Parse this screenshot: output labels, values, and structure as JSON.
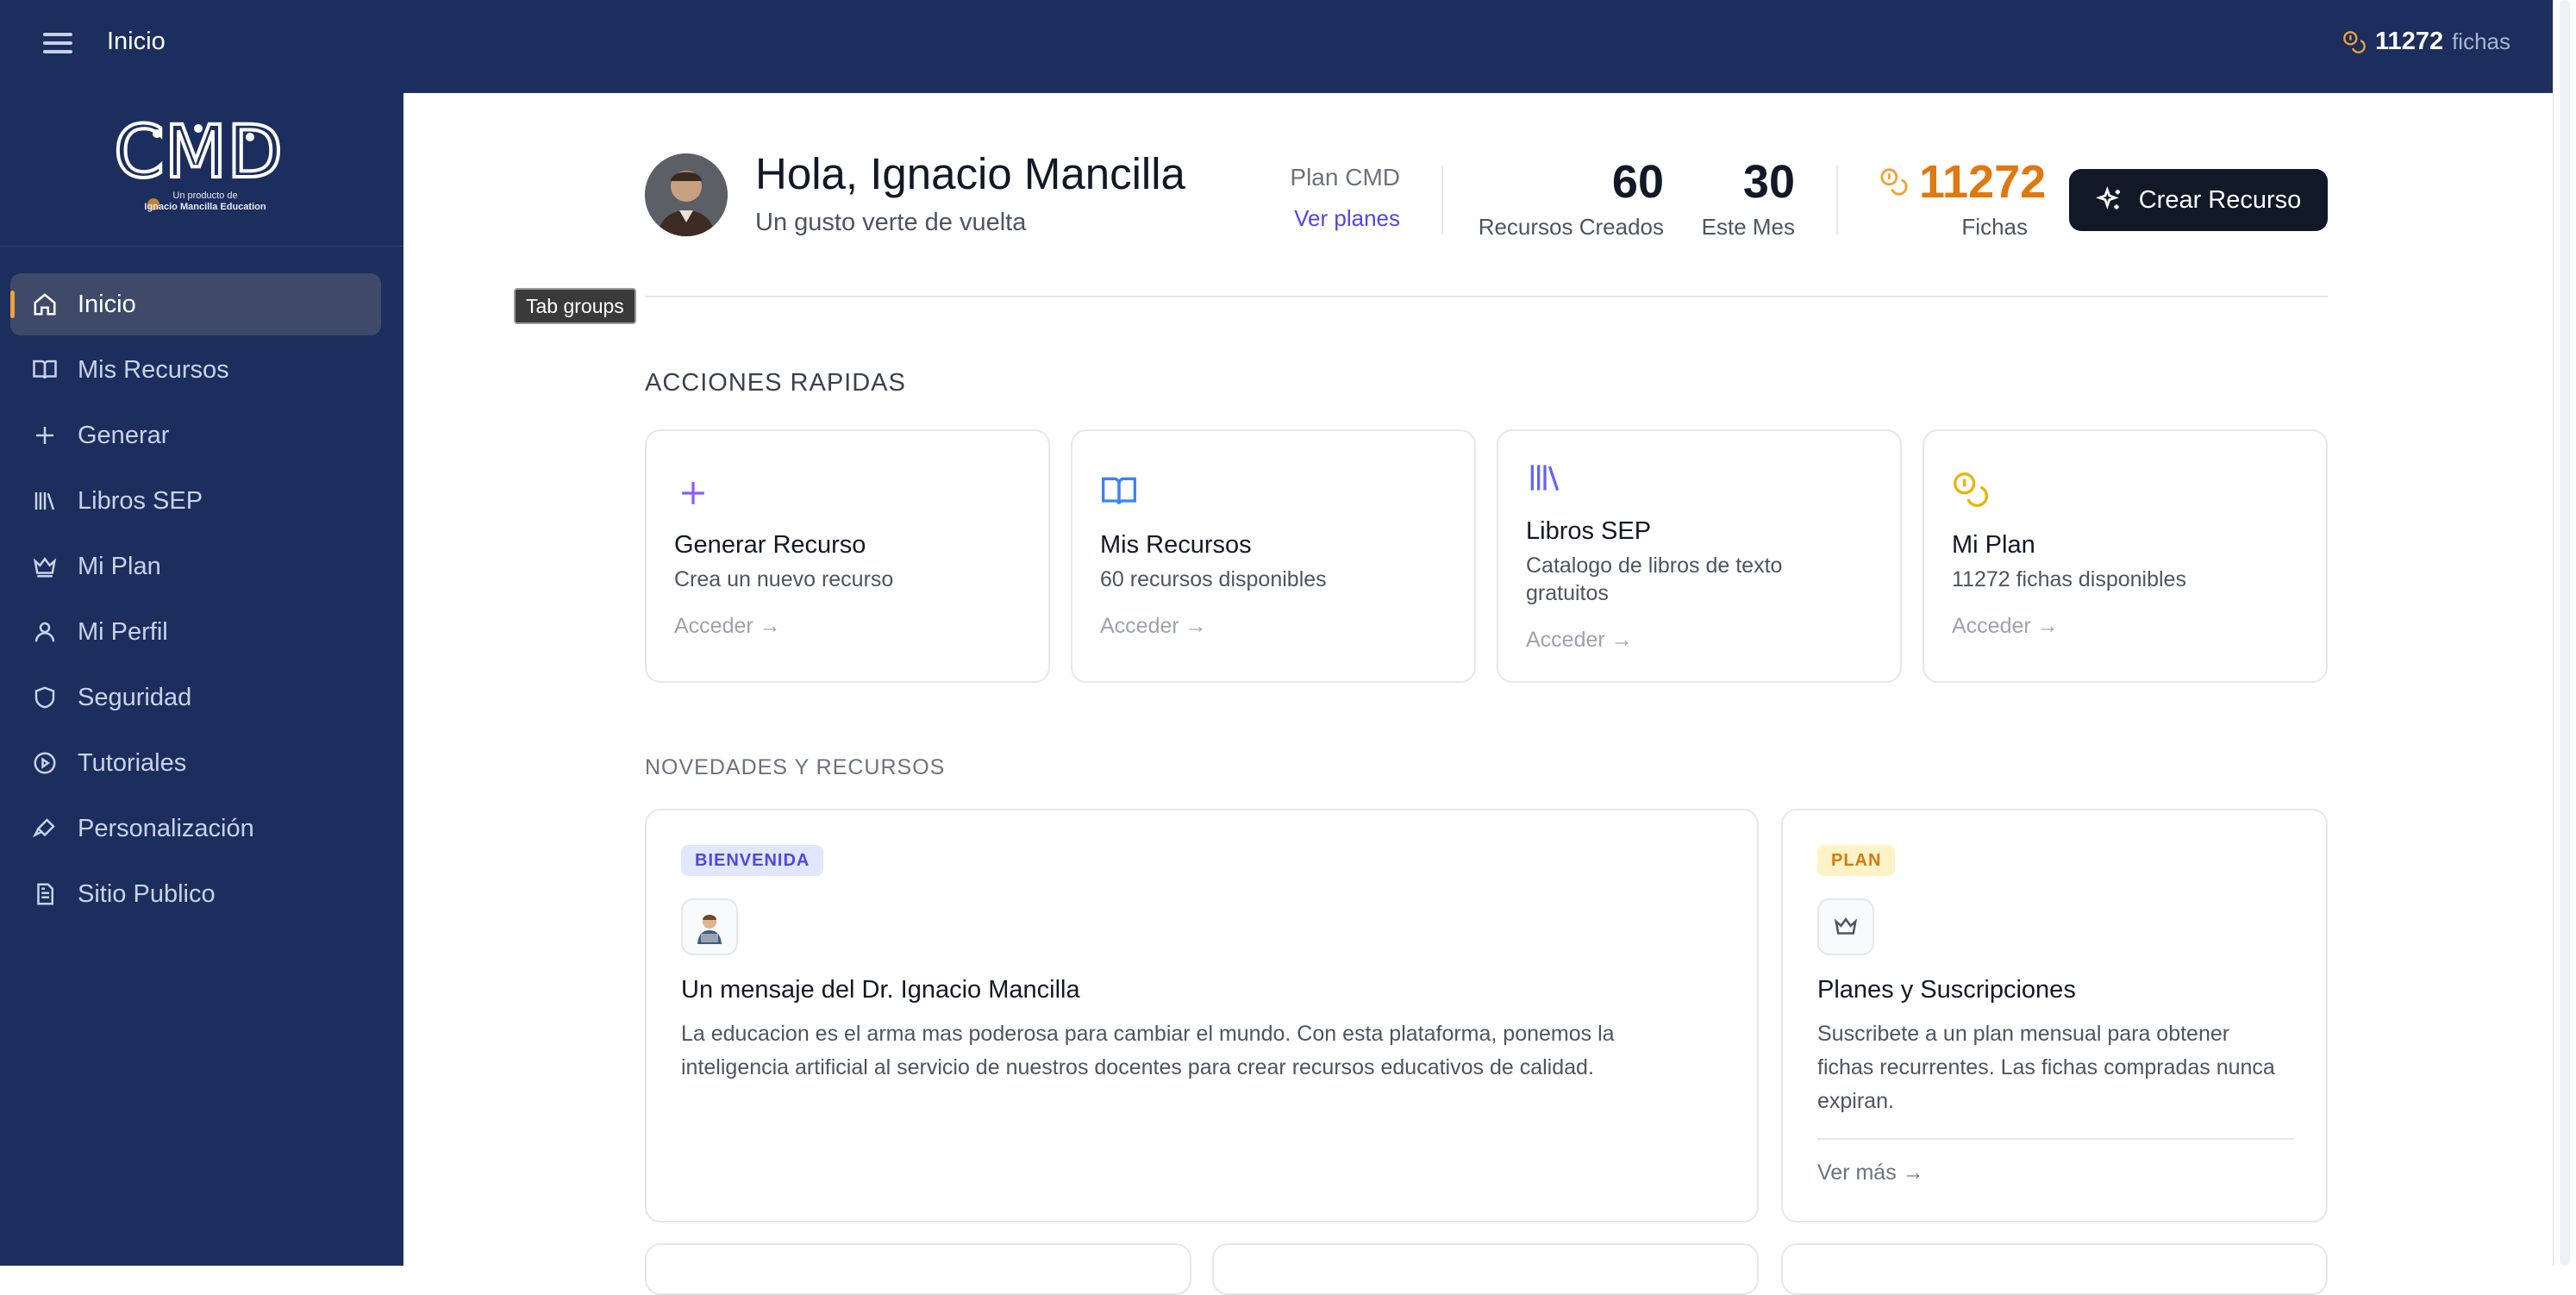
{
  "topbar": {
    "title": "Inicio",
    "tokens_value": "11272",
    "tokens_unit": "fichas"
  },
  "sidebar": {
    "logo_text": "CMD",
    "logo_sub_line1": "Un producto de",
    "logo_sub_line2": "Ignacio Mancilla Education",
    "items": [
      {
        "label": "Inicio",
        "icon": "home-icon",
        "active": true
      },
      {
        "label": "Mis Recursos",
        "icon": "book-open-icon"
      },
      {
        "label": "Generar",
        "icon": "plus-icon"
      },
      {
        "label": "Libros SEP",
        "icon": "library-icon"
      },
      {
        "label": "Mi Plan",
        "icon": "crown-icon"
      },
      {
        "label": "Mi Perfil",
        "icon": "user-icon"
      },
      {
        "label": "Seguridad",
        "icon": "shield-icon"
      },
      {
        "label": "Tutoriales",
        "icon": "play-circle-icon"
      },
      {
        "label": "Personalización",
        "icon": "brush-icon"
      },
      {
        "label": "Sitio Publico",
        "icon": "file-text-icon"
      }
    ]
  },
  "header": {
    "greeting": "Hola, Ignacio Mancilla",
    "subtitle": "Un gusto verte de vuelta",
    "plan_name": "Plan CMD",
    "plan_link": "Ver planes",
    "stats": [
      {
        "value": "60",
        "label": "Recursos Creados"
      },
      {
        "value": "30",
        "label": "Este Mes"
      }
    ],
    "tokens_value": "11272",
    "tokens_label": "Fichas",
    "cta_label": "Crear Recurso"
  },
  "tooltip": "Tab groups",
  "quick_actions": {
    "heading": "ACCIONES RAPIDAS",
    "cards": [
      {
        "title": "Generar Recurso",
        "desc": "Crea un nuevo recurso",
        "link": "Acceder →",
        "icon": "plus-icon",
        "color": "#8b5cf6"
      },
      {
        "title": "Mis Recursos",
        "desc": "60 recursos disponibles",
        "link": "Acceder →",
        "icon": "book-open-icon",
        "color": "#3b82f6"
      },
      {
        "title": "Libros SEP",
        "desc": "Catalogo de libros de texto gratuitos",
        "link": "Acceder →",
        "icon": "library-icon",
        "color": "#6366f1"
      },
      {
        "title": "Mi Plan",
        "desc": "11272 fichas disponibles",
        "link": "Acceder →",
        "icon": "coins-icon",
        "color": "#eab308"
      }
    ]
  },
  "news": {
    "heading": "NOVEDADES Y RECURSOS",
    "cards": [
      {
        "badge": "BIENVENIDA",
        "badge_bg": "#e0e7ff",
        "badge_fg": "#4f46e5",
        "icon": "teacher-avatar-icon",
        "title": "Un mensaje del Dr. Ignacio Mancilla",
        "text_line1": "La educacion es el arma mas poderosa para cambiar el mundo. Con esta plataforma, ponemos la",
        "text_line2": "inteligencia artificial al servicio de nuestros docentes para crear recursos educativos de calidad."
      },
      {
        "badge": "PLAN",
        "badge_bg": "#fef3c7",
        "badge_fg": "#d97706",
        "icon": "crown-icon",
        "title": "Planes y Suscripciones",
        "text_line1": "Suscribete a un plan mensual para obtener",
        "text_line2": "fichas recurrentes. Las fichas compradas nunca",
        "text_line3": "expiran.",
        "link": "Ver más →"
      }
    ]
  },
  "colors": {
    "navy": "#1b2e5e",
    "accent_orange": "#e0780f",
    "link_indigo": "#4f46e5",
    "active_indicator": "#f0a236"
  }
}
